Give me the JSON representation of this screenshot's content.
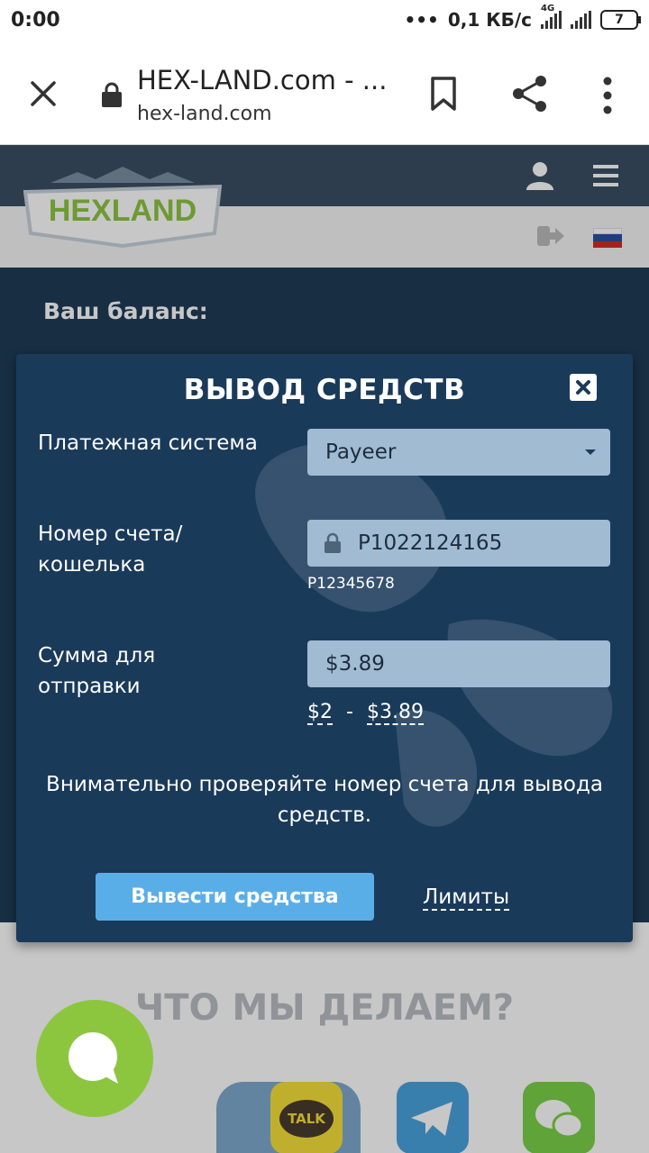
{
  "status_bar": {
    "time": "0:00",
    "net_speed": "0,1 КБ/с",
    "network_type": "4G",
    "battery": "7"
  },
  "browser": {
    "page_title": "HEX-LAND.com - ...",
    "url": "hex-land.com",
    "icons": [
      "close-icon",
      "lock-icon",
      "bookmark-icon",
      "share-icon",
      "more-vert-icon"
    ]
  },
  "site": {
    "logo_text": "HEXLAND",
    "balance_label": "Ваш баланс:",
    "section_title": "ЧТО МЫ ДЕЛАЕМ?",
    "messenger_badge": "TALK"
  },
  "modal": {
    "title": "ВЫВОД СРЕДСТВ",
    "payment_system_label": "Платежная система",
    "payment_system_value": "Payeer",
    "account_label_line1": "Номер счета/",
    "account_label_line2": "кошелька",
    "account_value": "P1022124165",
    "account_hint": "P12345678",
    "amount_label_line1": "Сумма для",
    "amount_label_line2": "отправки",
    "amount_value": "$3.89",
    "min_amount": "$2",
    "range_sep": "-",
    "max_amount": "$3.89",
    "notice": "Внимательно проверяйте номер счета для вывода средств.",
    "submit_label": "Вывести средства",
    "limits_label": "Лимиты"
  },
  "colors": {
    "modal_bg": "#1a3a5a",
    "field_bg": "#a1bcd2",
    "button_bg": "#5aaee8",
    "chat_fab": "#8cc63f"
  }
}
